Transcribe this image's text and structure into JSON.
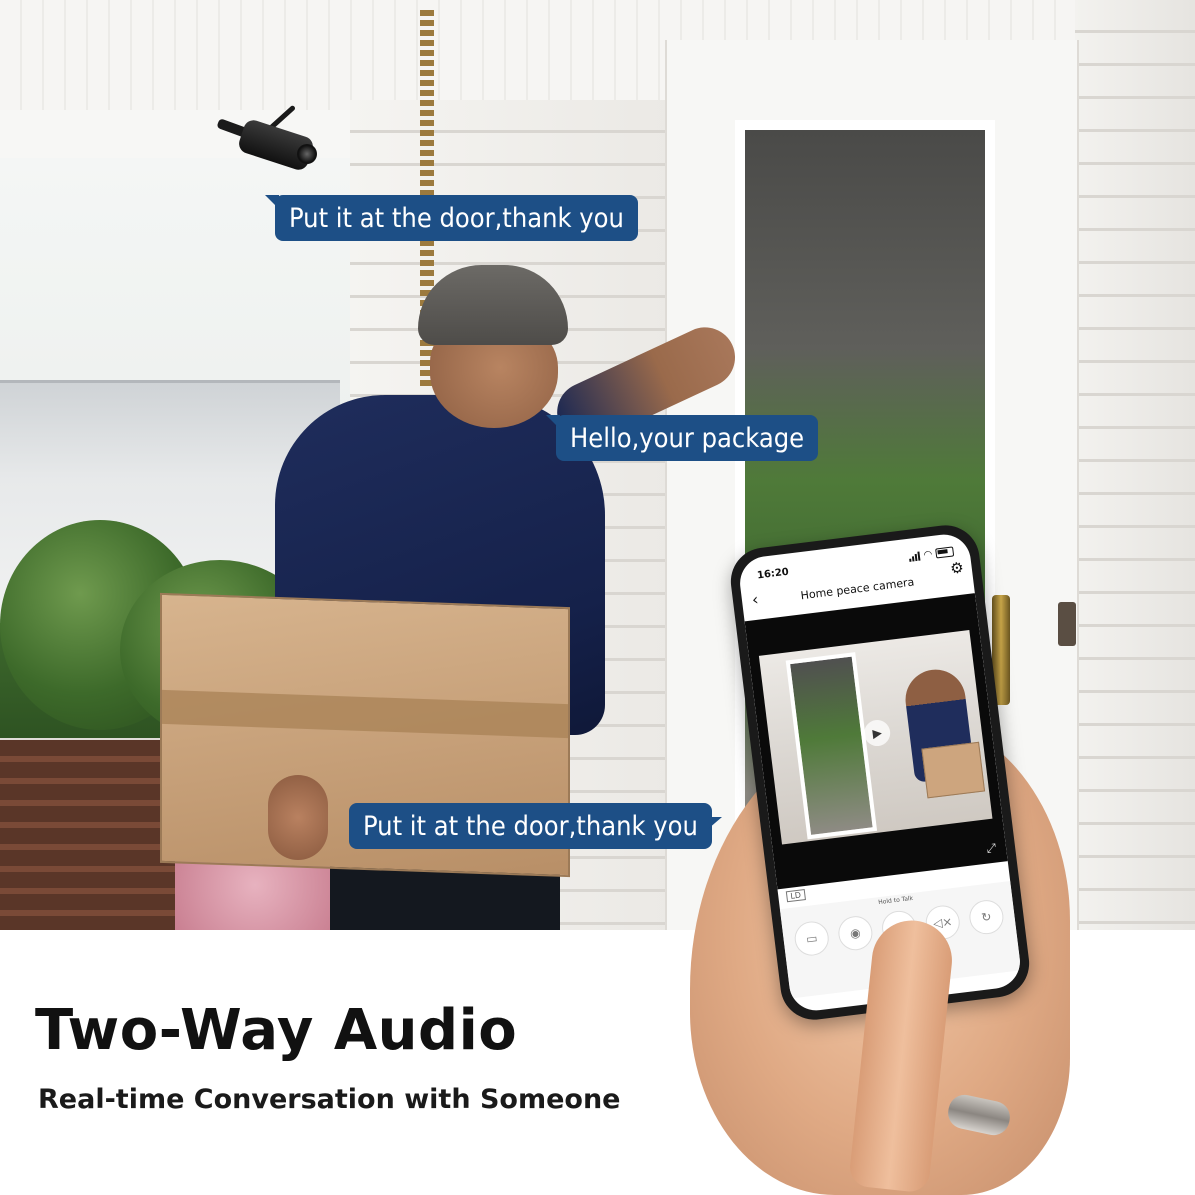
{
  "speech_bubbles": {
    "camera_reply": "Put it at the door,thank you",
    "courier": "Hello,your package",
    "phone_reply": "Put it at the door,thank you"
  },
  "phone": {
    "time": "16:20",
    "app_title": "Home peace camera",
    "hold_to_talk": "Hold to Talk",
    "quality_badge": "LD"
  },
  "caption": {
    "headline": "Two-Way Audio",
    "subheadline": "Real-time Conversation with Someone"
  },
  "colors": {
    "bubble": "#1d4f86",
    "headline": "#111111"
  }
}
